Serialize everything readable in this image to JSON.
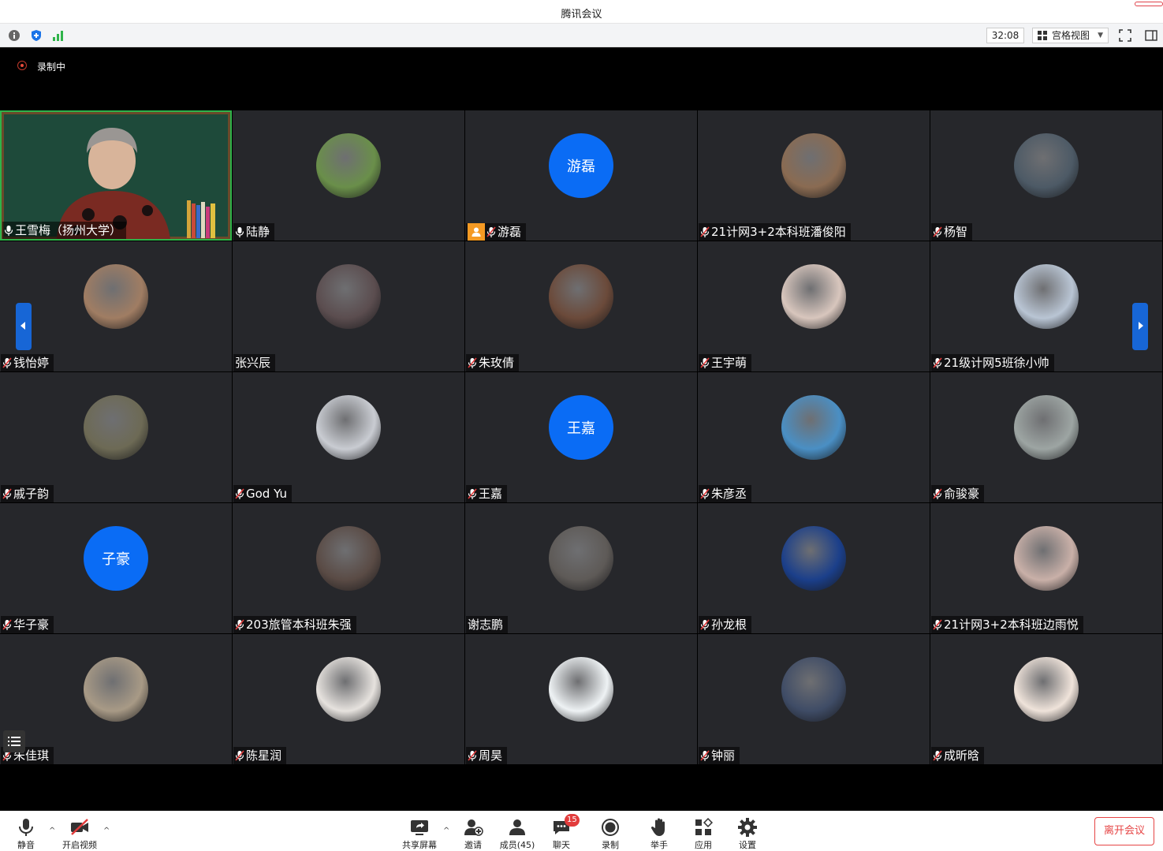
{
  "app": {
    "title": "腾讯会议"
  },
  "infobar": {
    "timer": "32:08",
    "view_label": "宫格视图"
  },
  "recording": {
    "label": "录制中"
  },
  "participants": [
    {
      "name": "王雪梅（扬州大学）",
      "mic": "on",
      "avatar": "video"
    },
    {
      "name": "陆静",
      "mic": "on",
      "avatar": "photo",
      "color": "#6a8f4a"
    },
    {
      "name": "游磊",
      "mic": "muted",
      "avatar": "text",
      "avatar_text": "游磊",
      "host": true
    },
    {
      "name": "21计网3+2本科班潘俊阳",
      "mic": "muted",
      "avatar": "photo",
      "color": "#8a6b52"
    },
    {
      "name": "杨智",
      "mic": "muted",
      "avatar": "photo",
      "color": "#4d5a66"
    },
    {
      "name": "钱怡婷",
      "mic": "muted",
      "avatar": "photo",
      "color": "#a07d63"
    },
    {
      "name": "张兴辰",
      "mic": "none",
      "avatar": "photo",
      "color": "#5b4d4f"
    },
    {
      "name": "朱玫倩",
      "mic": "muted",
      "avatar": "photo",
      "color": "#6b4a3a"
    },
    {
      "name": "王宇萌",
      "mic": "muted",
      "avatar": "photo",
      "color": "#d8c6bd"
    },
    {
      "name": "21级计网5班徐小帅",
      "mic": "muted",
      "avatar": "photo",
      "color": "#b9c5d4"
    },
    {
      "name": "戚子韵",
      "mic": "muted",
      "avatar": "photo",
      "color": "#6d6a55"
    },
    {
      "name": "God Yu",
      "mic": "muted",
      "avatar": "photo",
      "color": "#c9ccd2"
    },
    {
      "name": "王嘉",
      "mic": "muted",
      "avatar": "text",
      "avatar_text": "王嘉"
    },
    {
      "name": "朱彦丞",
      "mic": "muted",
      "avatar": "photo",
      "color": "#4a8fc4"
    },
    {
      "name": "俞骏豪",
      "mic": "muted",
      "avatar": "photo",
      "color": "#9da5a3"
    },
    {
      "name": "华子豪",
      "mic": "muted",
      "avatar": "text",
      "avatar_text": "子豪"
    },
    {
      "name": "203旅管本科班朱强",
      "mic": "muted",
      "avatar": "photo",
      "color": "#5a4b45"
    },
    {
      "name": "谢志鹏",
      "mic": "none",
      "avatar": "photo",
      "color": "#5e5a57"
    },
    {
      "name": "孙龙根",
      "mic": "muted",
      "avatar": "photo",
      "color": "#1b3f8a"
    },
    {
      "name": "21计网3+2本科班边雨悦",
      "mic": "muted",
      "avatar": "photo",
      "color": "#c9b0a8"
    },
    {
      "name": "朱佳琪",
      "mic": "muted",
      "avatar": "photo",
      "color": "#a89a86"
    },
    {
      "name": "陈星润",
      "mic": "muted",
      "avatar": "photo",
      "color": "#e6e2de"
    },
    {
      "name": "周昊",
      "mic": "muted",
      "avatar": "photo",
      "color": "#eef2f4"
    },
    {
      "name": "钟丽",
      "mic": "muted",
      "avatar": "photo",
      "color": "#3f4c66"
    },
    {
      "name": "成昕晗",
      "mic": "muted",
      "avatar": "photo",
      "color": "#efe3da"
    }
  ],
  "toolbar": {
    "mute": "静音",
    "video": "开启视频",
    "share": "共享屏幕",
    "invite": "邀请",
    "members": "成员(45)",
    "chat": "聊天",
    "chat_badge": "15",
    "record": "录制",
    "raise_hand": "举手",
    "apps": "应用",
    "settings": "设置",
    "leave": "离开会议"
  }
}
